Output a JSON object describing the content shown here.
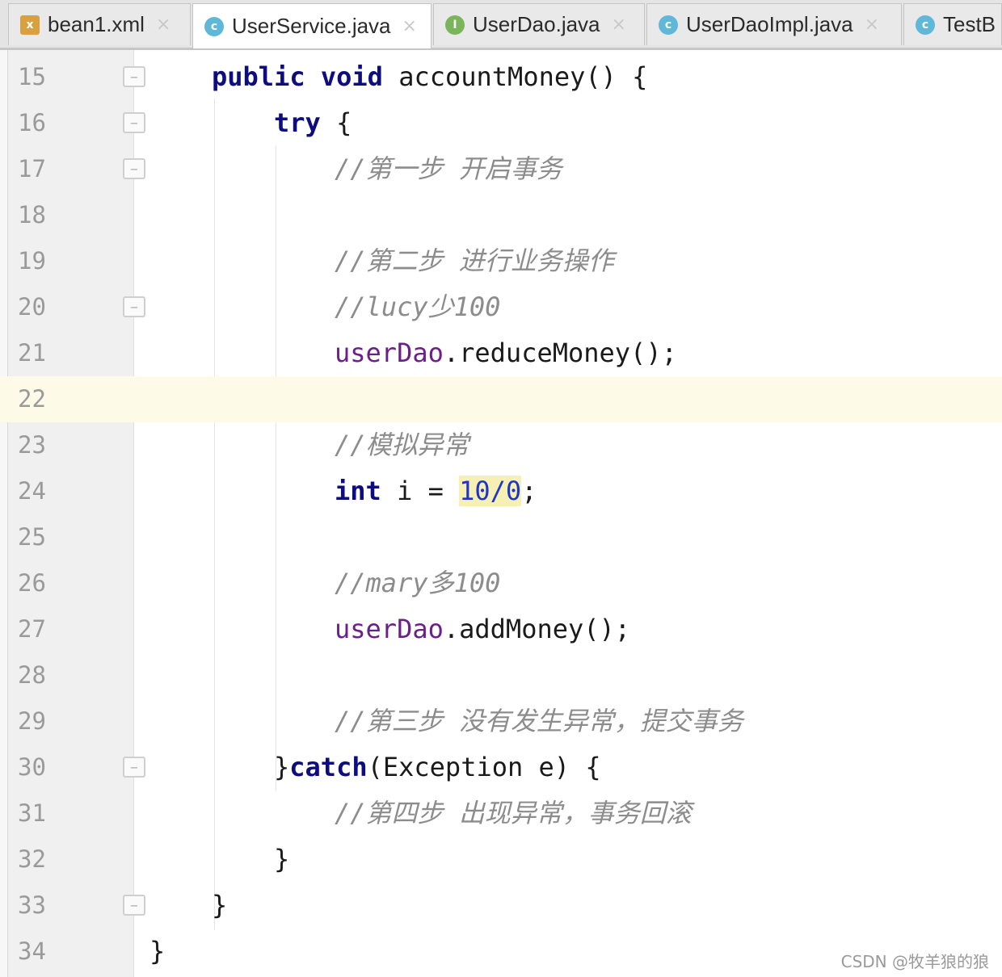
{
  "tabs": [
    {
      "label": "bean1.xml",
      "icon": "xml-file-icon",
      "active": false
    },
    {
      "label": "UserService.java",
      "icon": "class-icon",
      "active": true
    },
    {
      "label": "UserDao.java",
      "icon": "interface-icon",
      "active": false
    },
    {
      "label": "UserDaoImpl.java",
      "icon": "class-icon",
      "active": false
    },
    {
      "label": "TestB",
      "icon": "class-icon",
      "active": false
    }
  ],
  "tab_close_glyph": "×",
  "line_numbers": [
    "15",
    "16",
    "17",
    "18",
    "19",
    "20",
    "21",
    "22",
    "23",
    "24",
    "25",
    "26",
    "27",
    "28",
    "29",
    "30",
    "31",
    "32",
    "33",
    "34"
  ],
  "code": {
    "l15": {
      "kw1": "public",
      "kw2": "void",
      "text": " accountMoney() {"
    },
    "l16": {
      "kw": "try",
      "text": " {"
    },
    "l17": {
      "comment": "//第一步 开启事务"
    },
    "l19": {
      "comment": "//第二步 进行业务操作"
    },
    "l20": {
      "comment": "//lucy少100"
    },
    "l21": {
      "field": "userDao",
      "text": ".reduceMoney();"
    },
    "l23": {
      "comment": "//模拟异常"
    },
    "l24": {
      "kw": "int",
      "text": " i = ",
      "num": "10/0",
      "end": ";"
    },
    "l26": {
      "comment": "//mary多100"
    },
    "l27": {
      "field": "userDao",
      "text": ".addMoney();"
    },
    "l29": {
      "comment": "//第三步 没有发生异常，提交事务"
    },
    "l30": {
      "brace": "}",
      "kw": "catch",
      "text": "(Exception e) {"
    },
    "l31": {
      "comment": "//第四步 出现异常，事务回滚"
    },
    "l32": {
      "text": "}"
    },
    "l33": {
      "text": "}"
    },
    "l34": {
      "text": "}"
    }
  },
  "current_line": "22",
  "watermark": "CSDN @牧羊狼的狼",
  "colors": {
    "keyword": "#0d0d80",
    "comment": "#8c8c8c",
    "field": "#6a1f8a",
    "number": "#1d35c8",
    "current_line": "#fdfbe8",
    "highlight": "#f6f0b4"
  }
}
